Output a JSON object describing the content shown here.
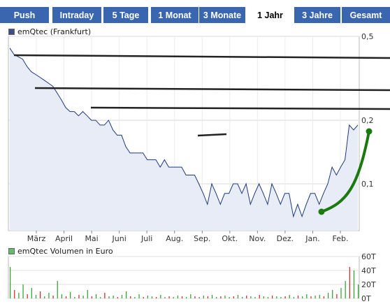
{
  "tabs": [
    {
      "label": "Push",
      "active": false
    },
    {
      "label": "Intraday",
      "active": false
    },
    {
      "label": "5 Tage",
      "active": false
    },
    {
      "label": "1 Monat",
      "active": false
    },
    {
      "label": "3 Monate",
      "active": false
    },
    {
      "label": "1 Jahr",
      "active": true
    },
    {
      "label": "3 Jahre",
      "active": false
    },
    {
      "label": "Gesamt",
      "active": false
    }
  ],
  "price_legend": "emQtec (Frankfurt)",
  "volume_legend": "emQtec Volumen in Euro",
  "colors": {
    "tab_bg": "#3a66b0",
    "price_line": "#1f3a7a",
    "area": "#e8ecf7",
    "annotation_black": "#222222",
    "annotation_green": "#1a7a10",
    "vol_up": "#2aa02a",
    "vol_down": "#d42020"
  },
  "chart_data": [
    {
      "type": "line",
      "title": "",
      "series": [
        {
          "name": "emQtec (Frankfurt)",
          "values": [
            0.44,
            0.41,
            0.4,
            0.39,
            0.36,
            0.34,
            0.33,
            0.32,
            0.31,
            0.3,
            0.29,
            0.27,
            0.25,
            0.23,
            0.22,
            0.22,
            0.21,
            0.22,
            0.21,
            0.2,
            0.2,
            0.19,
            0.19,
            0.2,
            0.18,
            0.17,
            0.17,
            0.15,
            0.14,
            0.14,
            0.14,
            0.14,
            0.13,
            0.13,
            0.13,
            0.12,
            0.13,
            0.12,
            0.12,
            0.12,
            0.12,
            0.11,
            0.11,
            0.11,
            0.1,
            0.09,
            0.08,
            0.1,
            0.09,
            0.08,
            0.09,
            0.09,
            0.1,
            0.1,
            0.09,
            0.1,
            0.08,
            0.09,
            0.1,
            0.09,
            0.08,
            0.1,
            0.09,
            0.08,
            0.09,
            0.09,
            0.07,
            0.08,
            0.07,
            0.08,
            0.09,
            0.09,
            0.08,
            0.09,
            0.1,
            0.12,
            0.11,
            0.12,
            0.13,
            0.19,
            0.18,
            0.19
          ]
        }
      ],
      "x_tick_labels": [
        "März",
        "April",
        "Mai",
        "Juni",
        "Juli",
        "Aug.",
        "Sep.",
        "Okt.",
        "Nov.",
        "Dez.",
        "Jan.",
        "Feb."
      ],
      "y_tick_labels": [
        "0,5",
        "0,2",
        "0,1"
      ],
      "y_scale": "log",
      "ylim": [
        0.06,
        0.5
      ]
    },
    {
      "type": "bar",
      "title": "",
      "series": [
        {
          "name": "emQtec Volumen in Euro",
          "values": [
            45000,
            12000,
            8000,
            20000,
            6000,
            15000,
            5000,
            10000,
            3000,
            8000,
            4000,
            25000,
            6000,
            3000,
            9000,
            2000,
            5000,
            4000,
            12000,
            3000,
            6000,
            2000,
            8000,
            3000,
            4000,
            2000,
            5000,
            10000,
            3000,
            2000,
            6000,
            2000,
            4000,
            3000,
            2000,
            5000,
            2000,
            3000,
            2000,
            4000,
            3000,
            2000,
            6000,
            3000,
            2000,
            4000,
            3000,
            5000,
            2000,
            3000,
            4000,
            2000,
            3000,
            5000,
            2000,
            4000,
            3000,
            2000,
            5000,
            3000,
            2000,
            4000,
            3000,
            2000,
            3000,
            5000,
            2000,
            4000,
            3000,
            6000,
            3000,
            4000,
            5000,
            3000,
            8000,
            12000,
            6000,
            15000,
            25000,
            45000,
            40000,
            20000
          ]
        }
      ],
      "y_tick_labels": [
        "60T",
        "40T",
        "20T",
        "0T"
      ],
      "ylim": [
        0,
        60000
      ]
    }
  ]
}
